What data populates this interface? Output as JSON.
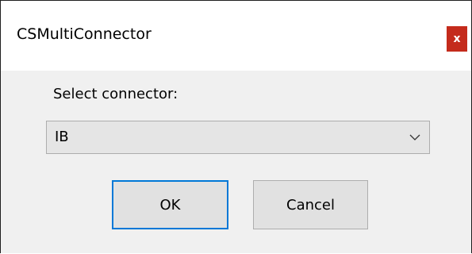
{
  "window": {
    "title": "CSMultiConnector",
    "close_label": "x"
  },
  "form": {
    "label": "Select connector:",
    "selected_value": "IB"
  },
  "buttons": {
    "ok_label": "OK",
    "cancel_label": "Cancel"
  },
  "colors": {
    "accent": "#0078d7",
    "close": "#c42b1c"
  }
}
